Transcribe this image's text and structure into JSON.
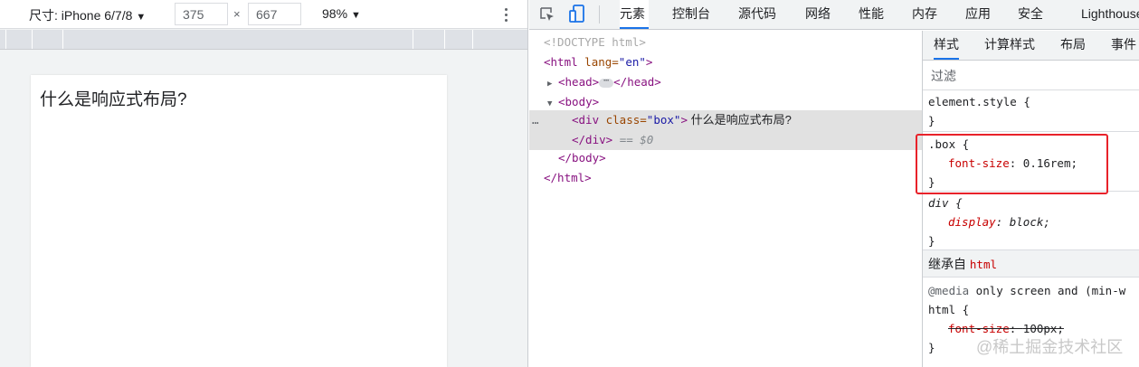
{
  "device_toolbar": {
    "device_label": "尺寸: iPhone 6/7/8",
    "width_value": "375",
    "times": "×",
    "height_value": "667",
    "zoom_label": "98%",
    "caret": "▼"
  },
  "viewport": {
    "content_text": "什么是响应式布局?"
  },
  "devtools_tabs": [
    "元素",
    "控制台",
    "源代码",
    "网络",
    "性能",
    "内存",
    "应用",
    "安全",
    "Lighthouse"
  ],
  "elements": {
    "doctype": "<!DOCTYPE html>",
    "html_open_tag": "<html",
    "html_attr": " lang=",
    "html_attr_val": "\"en\"",
    "html_close_bracket": ">",
    "head_open": "<head>",
    "head_ellipsis": "⋯",
    "head_close": "</head>",
    "body_open": "<body>",
    "div_open": "<div",
    "div_attr": " class=",
    "div_attr_val": "\"box\"",
    "div_close_bracket": ">",
    "div_text": " 什么是响应式布局?",
    "div_close": "</div>",
    "selected_marker": "== $0",
    "row_dots": "…",
    "body_close": "</body>",
    "html_close": "</html>"
  },
  "styles": {
    "tabs": [
      "样式",
      "计算样式",
      "布局",
      "事件"
    ],
    "filter_placeholder": "过滤",
    "element_style_selector": "element.style {",
    "close_brace": "}",
    "box_selector": ".box {",
    "box_prop": "font-size",
    "box_value": "0.16rem;",
    "div_selector": "div {",
    "div_prop": "display",
    "div_value": "block;",
    "inherited_label": "继承自 ",
    "inherited_tag": "html",
    "media_keyword": "@media",
    "media_query": " only screen and (min-w",
    "html_selector": "html {",
    "html_prop": "font-size",
    "html_value": "100px;",
    "colon": ": "
  },
  "watermark": "@稀土掘金技术社区",
  "colors": {
    "accent": "#1a73e8",
    "highlight_box": "#e8222a",
    "tag": "#881280",
    "property": "#c80000"
  }
}
